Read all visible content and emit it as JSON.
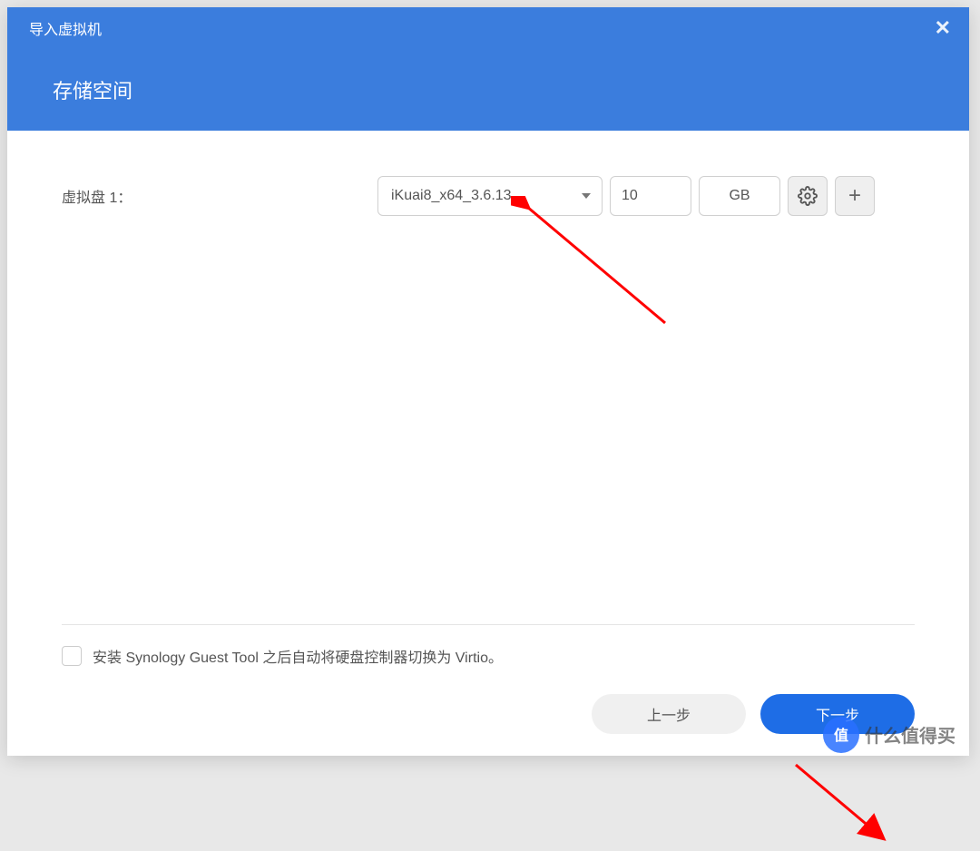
{
  "dialog": {
    "title": "导入虚拟机",
    "sectionTitle": "存储空间"
  },
  "disk": {
    "label": "虚拟盘 1：",
    "selected": "iKuai8_x64_3.6.13",
    "size": "10",
    "unit": "GB"
  },
  "footer": {
    "checkboxLabel": "安装 Synology Guest Tool 之后自动将硬盘控制器切换为 Virtio。",
    "prevButton": "上一步",
    "nextButton": "下一步"
  },
  "watermark": {
    "text": "什么值得买"
  }
}
